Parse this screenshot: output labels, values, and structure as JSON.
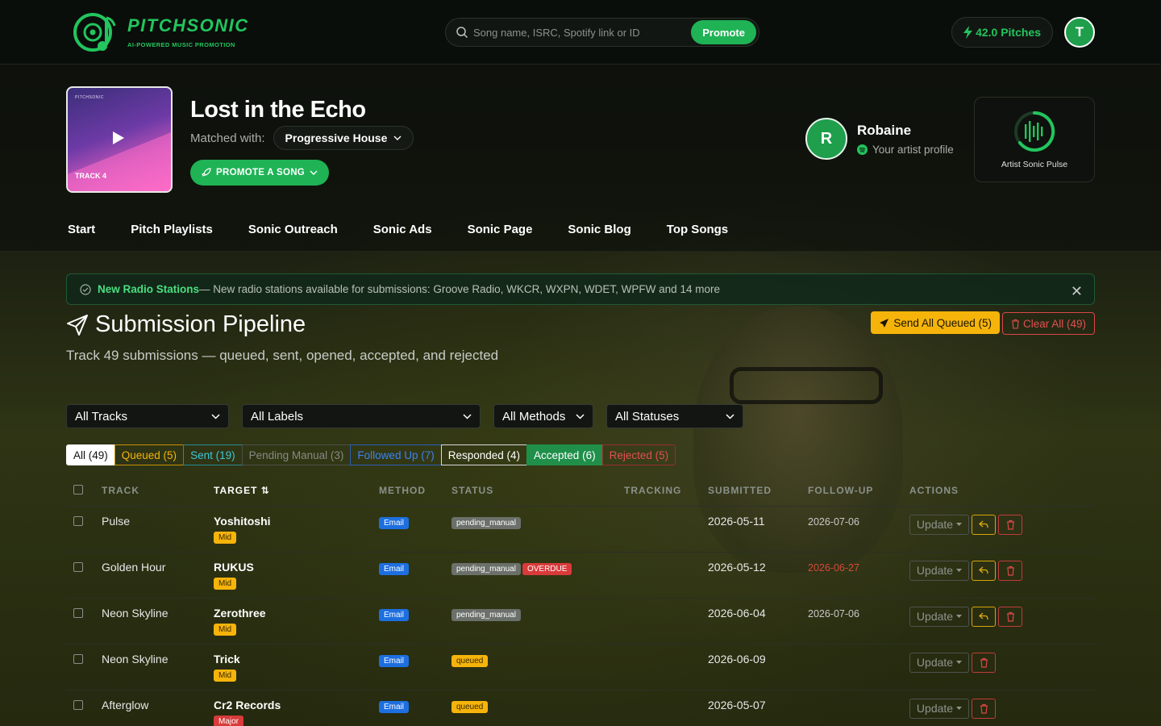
{
  "brand": {
    "name": "PITCHSONIC",
    "tagline": "AI-POWERED MUSIC PROMOTION"
  },
  "search": {
    "placeholder": "Song name, ISRC, Spotify link or ID",
    "button": "Promote"
  },
  "user": {
    "pitches": "42.0 Pitches",
    "initial": "T"
  },
  "track": {
    "cover_small": "PITCHSONIC",
    "cover_label": "TRACK 4",
    "title": "Lost in the Echo",
    "matched_label": "Matched with:",
    "genre": "Progressive House",
    "promote_button": "PROMOTE A SONG"
  },
  "artist": {
    "initial": "R",
    "name": "Robaine",
    "profile_link": "Your artist profile",
    "pulse_label": "Artist Sonic Pulse"
  },
  "nav": [
    "Start",
    "Pitch Playlists",
    "Sonic Outreach",
    "Sonic Ads",
    "Sonic Page",
    "Sonic Blog",
    "Top Songs"
  ],
  "alert": {
    "title": "New Radio Stations",
    "text": " — New radio stations available for submissions: Groove Radio, WKCR, WXPN, WDET, WPFW and 14 more"
  },
  "pipeline": {
    "title": "Submission Pipeline",
    "subtitle": "Track 49 submissions — queued, sent, opened, accepted, and rejected",
    "send_button": "Send All Queued (5)",
    "clear_button": "Clear All (49)"
  },
  "filters": {
    "tracks": "All Tracks",
    "labels": "All Labels",
    "methods": "All Methods",
    "statuses": "All Statuses"
  },
  "tabs": {
    "all": "All (49)",
    "queued": "Queued (5)",
    "sent": "Sent (19)",
    "pending": "Pending Manual (3)",
    "followed": "Followed Up (7)",
    "responded": "Responded (4)",
    "accepted": "Accepted (6)",
    "rejected": "Rejected (5)"
  },
  "table": {
    "headers": {
      "track": "TRACK",
      "target": "TARGET",
      "method": "METHOD",
      "status": "STATUS",
      "tracking": "TRACKING",
      "submitted": "SUBMITTED",
      "followup": "FOLLOW-UP",
      "actions": "ACTIONS"
    },
    "update_label": "Update",
    "rows": [
      {
        "track": "Pulse",
        "target": "Yoshitoshi",
        "tier": "Mid",
        "method": "Email",
        "status": "pending_manual",
        "overdue": "",
        "submitted": "2026-05-11",
        "followup": "2026-07-06"
      },
      {
        "track": "Golden Hour",
        "target": "RUKUS",
        "tier": "Mid",
        "method": "Email",
        "status": "pending_manual",
        "overdue": "OVERDUE",
        "submitted": "2026-05-12",
        "followup": "2026-06-27"
      },
      {
        "track": "Neon Skyline",
        "target": "Zerothree",
        "tier": "Mid",
        "method": "Email",
        "status": "pending_manual",
        "overdue": "",
        "submitted": "2026-06-04",
        "followup": "2026-07-06"
      },
      {
        "track": "Neon Skyline",
        "target": "Trick",
        "tier": "Mid",
        "method": "Email",
        "status": "queued",
        "overdue": "",
        "submitted": "2026-06-09",
        "followup": ""
      },
      {
        "track": "Afterglow",
        "target": "Cr2 Records",
        "tier": "Major",
        "method": "Email",
        "status": "queued",
        "overdue": "",
        "submitted": "2026-05-07",
        "followup": ""
      }
    ]
  },
  "colors": {
    "accent": "#1fb356",
    "warning": "#f6b40a",
    "danger": "#d93a3a"
  }
}
